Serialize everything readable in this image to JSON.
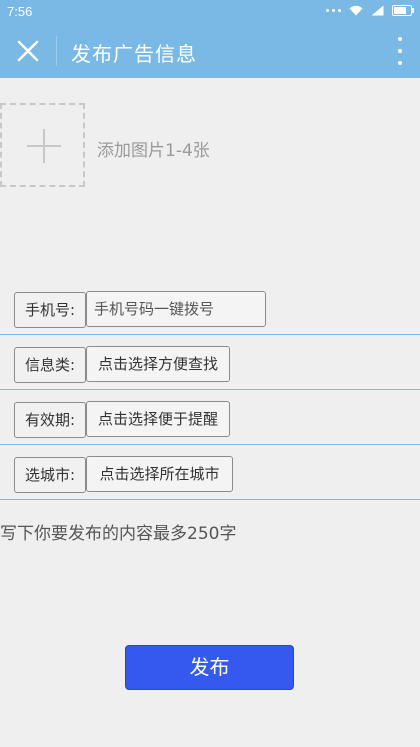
{
  "status_bar": {
    "time": "7:56"
  },
  "app_bar": {
    "title": "发布广告信息"
  },
  "image_upload": {
    "label": "添加图片1-4张"
  },
  "form": {
    "phone": {
      "label": "手机号:",
      "placeholder": "手机号码一键拨号"
    },
    "category": {
      "label": "信息类:",
      "value": "点击选择方便查找"
    },
    "validity": {
      "label": "有效期:",
      "value": "点击选择便于提醒"
    },
    "city": {
      "label": "选城市:",
      "value": "点击选择所在城市"
    }
  },
  "content": {
    "placeholder": "写下你要发布的内容最多250字"
  },
  "actions": {
    "publish_label": "发布"
  },
  "colors": {
    "app_bar": "#7ab9e6",
    "publish_button": "#3559ef",
    "underline": "#7ab9e6",
    "background": "#efefef"
  }
}
